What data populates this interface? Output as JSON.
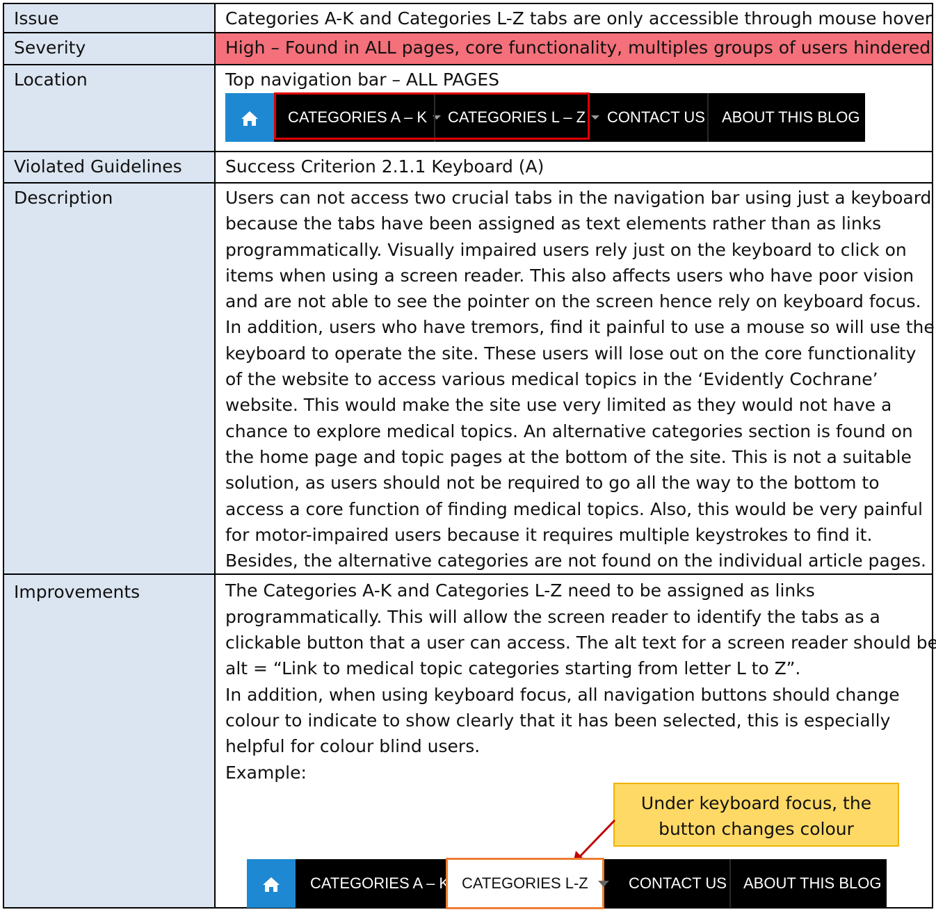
{
  "rows": {
    "issue": {
      "label": "Issue",
      "value": "Categories A-K and Categories L-Z tabs are only accessible through mouse hover"
    },
    "severity": {
      "label": "Severity",
      "value": "High – Found in ALL pages, core functionality, multiples groups of users hindered",
      "bg_color": "#f4707a"
    },
    "location": {
      "label": "Location",
      "value": "Top navigation bar – ALL PAGES"
    },
    "guidelines": {
      "label": "Violated Guidelines",
      "value": "Success Criterion 2.1.1 Keyboard (A)"
    },
    "description": {
      "label": "Description",
      "lines": [
        "Users can not access two crucial tabs in the navigation bar using just a keyboard",
        "because the tabs have been assigned as text elements rather than as links",
        "programmatically. Visually impaired users rely just on the keyboard to click on",
        "items when using a screen reader. This also affects users who have poor vision",
        "and are not able to see the pointer on the screen hence rely on keyboard focus.",
        "In addition, users who have tremors, find it painful to use a mouse so will use the",
        "keyboard to operate the site. These users will lose out on the core functionality",
        "of the website to access various medical topics in the ‘Evidently Cochrane’",
        "website. This would make the site use very limited as they would not have a",
        "chance to explore medical topics. An alternative categories section is found on",
        "the home page and topic pages at the bottom of the site. This is not a suitable",
        "solution, as users should not be required to go all the way to the bottom to",
        "access a core function of finding medical topics. Also, this would be very painful",
        "for motor-impaired users because it requires multiple keystrokes to find it.",
        "Besides, the alternative categories are not found on the individual article pages."
      ]
    },
    "improvements": {
      "label": "Improvements",
      "lines": [
        "The Categories A-K and Categories L-Z need to be assigned as links",
        "programmatically. This will allow the screen reader to identify the tabs as a",
        "clickable button that a user can access. The alt text for a screen reader should be:",
        "alt = “Link to medical topic categories starting from letter L to Z”.",
        "In addition, when using keyboard focus, all navigation buttons should change",
        "colour to indicate to show clearly that it has been selected, this is especially",
        "helpful for colour blind users.",
        "Example:"
      ],
      "callout_lines": [
        "Under keyboard focus, the",
        "button changes colour"
      ]
    }
  },
  "nav_top": {
    "cat_ak": "CATEGORIES A – K",
    "cat_lz": "CATEGORIES L – Z",
    "contact": "CONTACT US",
    "about": "ABOUT THIS BLOG",
    "highlight_color": "#e00000"
  },
  "nav_bottom": {
    "cat_ak": "CATEGORIES A – K",
    "cat_lz": "CATEGORIES L-Z",
    "contact": "CONTACT US",
    "about": "ABOUT THIS BLOG",
    "focus_color": "#ed7d31"
  },
  "colors": {
    "label_bg": "#dbe5f1",
    "nav_bg": "#000000",
    "home_bg": "#1e88d2",
    "callout_bg": "#ffd966",
    "arrow": "#c00000"
  }
}
